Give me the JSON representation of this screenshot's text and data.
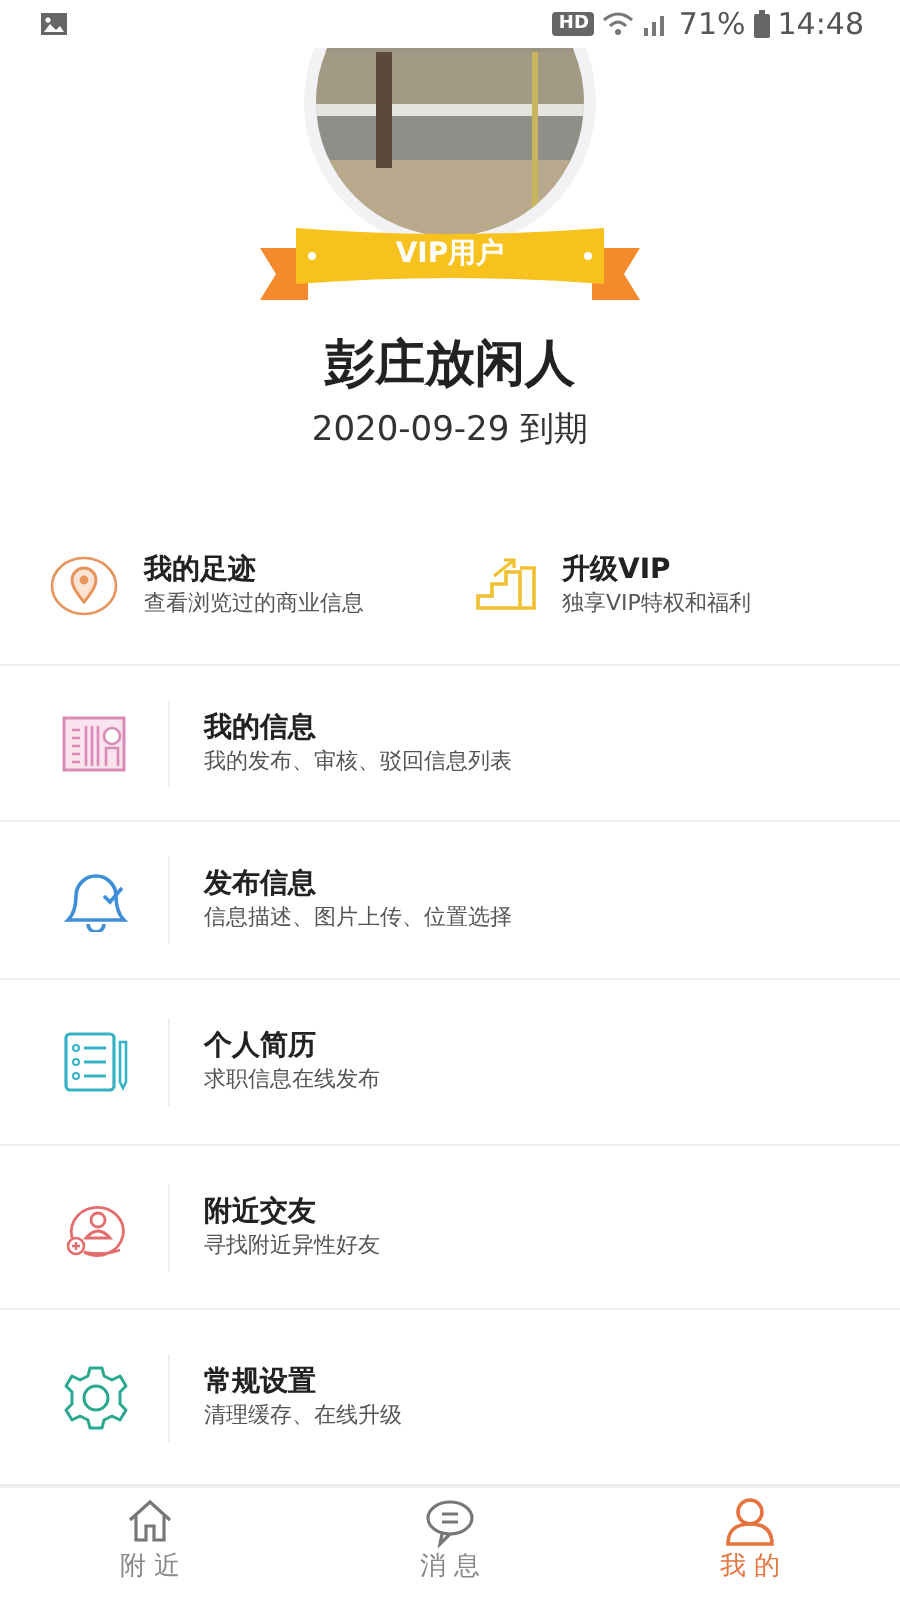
{
  "status_bar": {
    "hd": "HD",
    "battery": "71%",
    "time": "14:48"
  },
  "profile": {
    "badge": "VIP用户",
    "name": "彭庄放闲人",
    "expiry": "2020-09-29 到期"
  },
  "quick_links": [
    {
      "title": "我的足迹",
      "subtitle": "查看浏览过的商业信息"
    },
    {
      "title": "升级VIP",
      "subtitle": "独享VIP特权和福利"
    }
  ],
  "menu": [
    {
      "title": "我的信息",
      "subtitle": "我的发布、审核、驳回信息列表"
    },
    {
      "title": "发布信息",
      "subtitle": "信息描述、图片上传、位置选择"
    },
    {
      "title": "个人简历",
      "subtitle": "求职信息在线发布"
    },
    {
      "title": "附近交友",
      "subtitle": "寻找附近异性好友"
    },
    {
      "title": "常规设置",
      "subtitle": "清理缓存、在线升级"
    }
  ],
  "bottom_nav": [
    {
      "label": "附 近",
      "selected": false
    },
    {
      "label": "消 息",
      "selected": false
    },
    {
      "label": "我 的",
      "selected": true
    }
  ]
}
